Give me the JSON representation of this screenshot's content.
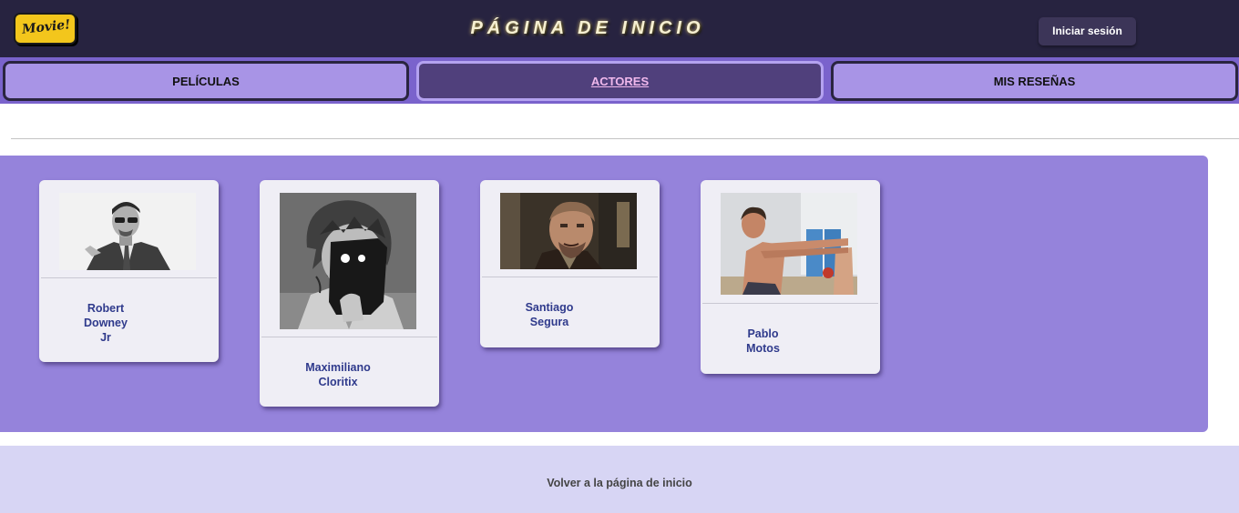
{
  "header": {
    "logo_text": "Movie!",
    "title": "PÁGINA DE INICIO",
    "login_label": "Iniciar sesión"
  },
  "nav": {
    "tabs": [
      {
        "label": "PELÍCULAS",
        "active": false
      },
      {
        "label": "ACTORES",
        "active": true
      },
      {
        "label": "MIS RESEÑAS",
        "active": false
      }
    ]
  },
  "actors": [
    {
      "name_lines": [
        "Robert",
        "Downey",
        "Jr"
      ],
      "photo_icon": "actor-photo-suit"
    },
    {
      "name_lines": [
        "Maximiliano",
        "Cloritix"
      ],
      "photo_icon": "actor-photo-masked-illustration"
    },
    {
      "name_lines": [
        "Santiago",
        "Segura"
      ],
      "photo_icon": "actor-photo-portrait"
    },
    {
      "name_lines": [
        "Pablo",
        "Motos"
      ],
      "photo_icon": "actor-photo-gym"
    }
  ],
  "footer": {
    "link_label": "Volver a la página de inicio"
  },
  "colors": {
    "header_bg": "#272340",
    "nav_bg": "#7a63cc",
    "tab_inactive": "#a894e6",
    "tab_active": "#50407c",
    "gallery_bg": "#9583db",
    "card_bg": "#efeef5",
    "name_text": "#2f3a8c",
    "footer_bg": "#d7d5f4"
  }
}
